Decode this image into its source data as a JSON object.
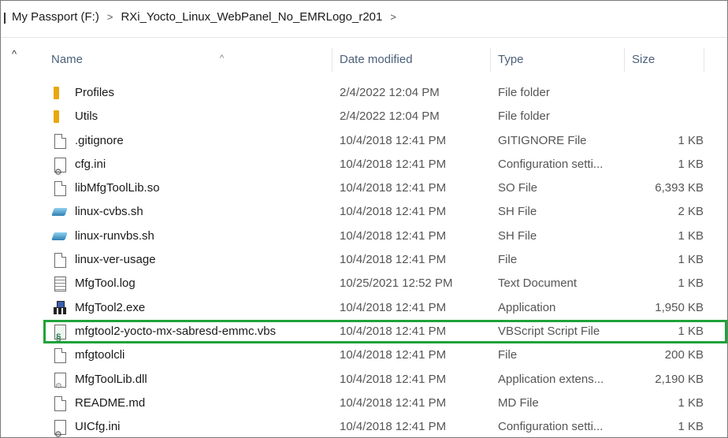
{
  "breadcrumb": [
    "My Passport (F:)",
    "RXi_Yocto_Linux_WebPanel_No_EMRLogo_r201"
  ],
  "breadcrumb_separator": ">",
  "columns": {
    "name": "Name",
    "date": "Date modified",
    "type": "Type",
    "size": "Size"
  },
  "files": [
    {
      "name": "Profiles",
      "date": "2/4/2022 12:04 PM",
      "type": "File folder",
      "size": "",
      "icon": "folder-icon"
    },
    {
      "name": "Utils",
      "date": "2/4/2022 12:04 PM",
      "type": "File folder",
      "size": "",
      "icon": "folder-icon"
    },
    {
      "name": ".gitignore",
      "date": "10/4/2018 12:41 PM",
      "type": "GITIGNORE File",
      "size": "1 KB",
      "icon": "file-icon"
    },
    {
      "name": "cfg.ini",
      "date": "10/4/2018 12:41 PM",
      "type": "Configuration setti...",
      "size": "1 KB",
      "icon": "settings-file-icon"
    },
    {
      "name": "libMfgToolLib.so",
      "date": "10/4/2018 12:41 PM",
      "type": "SO File",
      "size": "6,393 KB",
      "icon": "file-icon"
    },
    {
      "name": "linux-cvbs.sh",
      "date": "10/4/2018 12:41 PM",
      "type": "SH File",
      "size": "2 KB",
      "icon": "shell-script-icon"
    },
    {
      "name": "linux-runvbs.sh",
      "date": "10/4/2018 12:41 PM",
      "type": "SH File",
      "size": "1 KB",
      "icon": "shell-script-icon"
    },
    {
      "name": "linux-ver-usage",
      "date": "10/4/2018 12:41 PM",
      "type": "File",
      "size": "1 KB",
      "icon": "file-icon"
    },
    {
      "name": "MfgTool.log",
      "date": "10/25/2021 12:52 PM",
      "type": "Text Document",
      "size": "1 KB",
      "icon": "text-document-icon"
    },
    {
      "name": "MfgTool2.exe",
      "date": "10/4/2018 12:41 PM",
      "type": "Application",
      "size": "1,950 KB",
      "icon": "application-icon"
    },
    {
      "name": "mfgtool2-yocto-mx-sabresd-emmc.vbs",
      "date": "10/4/2018 12:41 PM",
      "type": "VBScript Script File",
      "size": "1 KB",
      "icon": "vbscript-icon",
      "highlighted": true
    },
    {
      "name": "mfgtoolcli",
      "date": "10/4/2018 12:41 PM",
      "type": "File",
      "size": "200 KB",
      "icon": "file-icon"
    },
    {
      "name": "MfgToolLib.dll",
      "date": "10/4/2018 12:41 PM",
      "type": "Application extens...",
      "size": "2,190 KB",
      "icon": "dll-icon"
    },
    {
      "name": "README.md",
      "date": "10/4/2018 12:41 PM",
      "type": "MD File",
      "size": "1 KB",
      "icon": "file-icon"
    },
    {
      "name": "UICfg.ini",
      "date": "10/4/2018 12:41 PM",
      "type": "Configuration setti...",
      "size": "1 KB",
      "icon": "settings-file-icon"
    }
  ],
  "highlight_color": "#1ea33a"
}
